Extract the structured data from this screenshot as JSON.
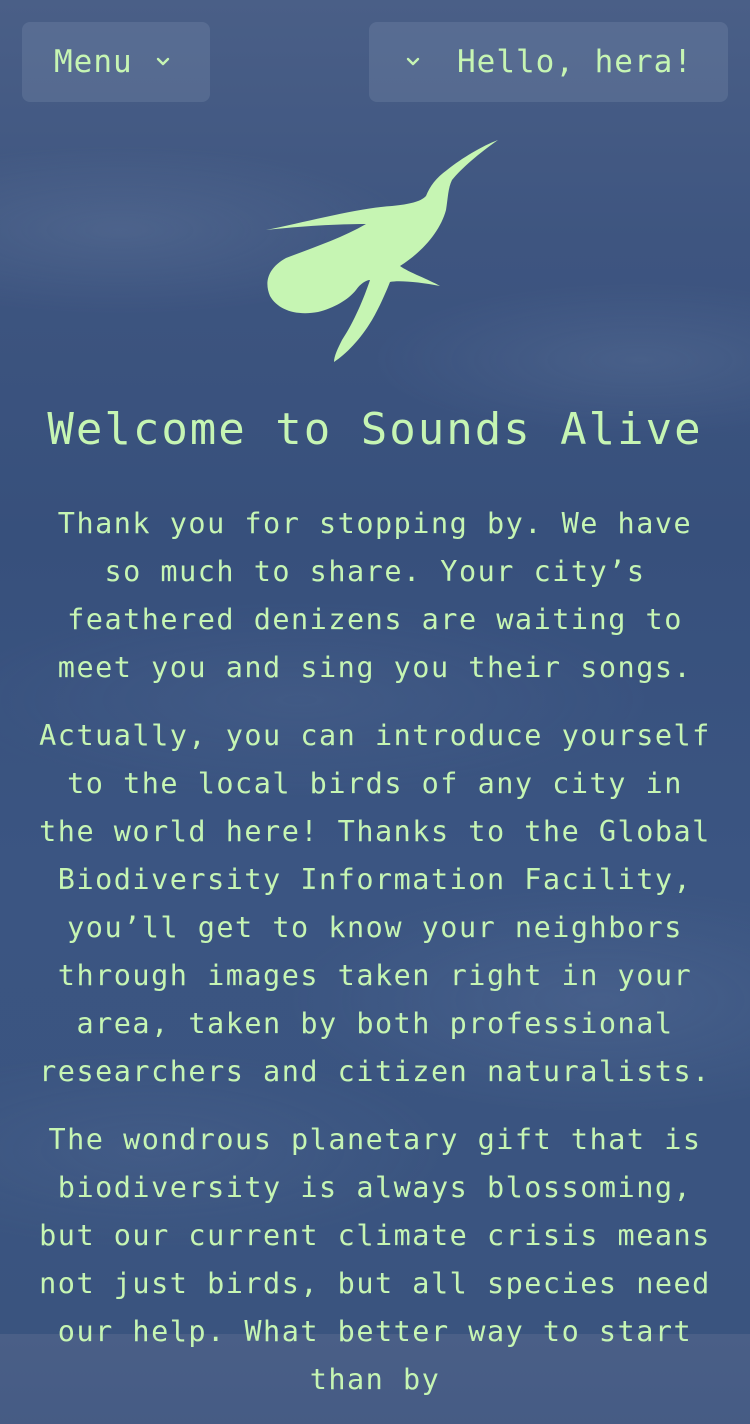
{
  "header": {
    "menu_label": "Menu",
    "greeting": "Hello, hera!",
    "menu_icon": "chevron-down-icon",
    "user_icon": "chevron-down-icon"
  },
  "logo": {
    "icon": "hummingbird-icon"
  },
  "main": {
    "title": "Welcome to Sounds Alive",
    "paragraphs": [
      "Thank you for stopping by. We have so much to share. Your city’s feathered denizens are waiting to meet you and sing you their songs.",
      "Actually, you can introduce yourself to the local birds of any city in the world here! Thanks to the Global Biodiversity Information Facility, you’ll get to know your neighbors through images taken right in your area, taken by both professional researchers and citizen naturalists.",
      "The wondrous planetary gift that is biodiversity is always blossoming, but our current climate crisis means not just birds, but all species need our help. What better way to start than by"
    ]
  },
  "colors": {
    "accent": "#c6f5b3",
    "background": "#3b5582",
    "button_bg": "#5b6d8f"
  }
}
